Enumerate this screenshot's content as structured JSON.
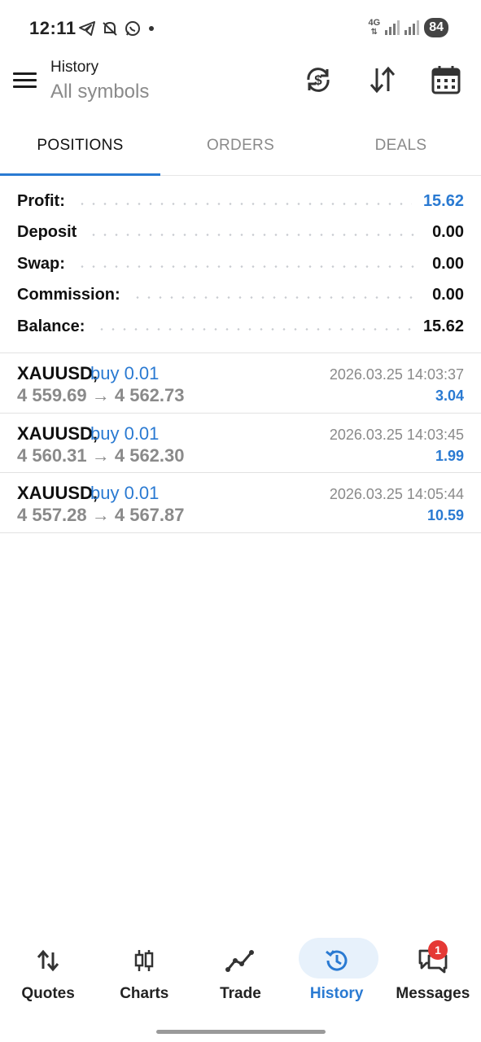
{
  "status_bar": {
    "time": "12:11",
    "network": "4G",
    "battery": "84",
    "left_icons": [
      "telegram-icon",
      "notification-muted-icon",
      "whatsapp-icon",
      "dot-icon"
    ]
  },
  "app_bar": {
    "title": "History",
    "subtitle": "All symbols",
    "icons": [
      "menu-icon",
      "currency-refresh-icon",
      "sort-icon",
      "calendar-icon"
    ]
  },
  "tabs": [
    {
      "label": "POSITIONS",
      "active": true
    },
    {
      "label": "ORDERS",
      "active": false
    },
    {
      "label": "DEALS",
      "active": false
    }
  ],
  "summary": [
    {
      "label": "Profit:",
      "value": "15.62",
      "highlight": true
    },
    {
      "label": "Deposit",
      "value": "0.00",
      "highlight": false
    },
    {
      "label": "Swap:",
      "value": "0.00",
      "highlight": false
    },
    {
      "label": "Commission:",
      "value": "0.00",
      "highlight": false
    },
    {
      "label": "Balance:",
      "value": "15.62",
      "highlight": false
    }
  ],
  "positions": [
    {
      "symbol": "XAUUSD,",
      "side": "buy 0.01",
      "prices": "4 559.69 → 4 562.73",
      "time": "2026.03.25 14:03:37",
      "profit": "3.04"
    },
    {
      "symbol": "XAUUSD,",
      "side": "buy 0.01",
      "prices": "4 560.31 → 4 562.30",
      "time": "2026.03.25 14:03:45",
      "profit": "1.99"
    },
    {
      "symbol": "XAUUSD,",
      "side": "buy 0.01",
      "prices": "4 557.28 → 4 567.87",
      "time": "2026.03.25 14:05:44",
      "profit": "10.59"
    }
  ],
  "bottom_nav": [
    {
      "label": "Quotes",
      "icon": "quotes-arrows-icon",
      "active": false
    },
    {
      "label": "Charts",
      "icon": "candlestick-icon",
      "active": false
    },
    {
      "label": "Trade",
      "icon": "trend-line-icon",
      "active": false
    },
    {
      "label": "History",
      "icon": "history-clock-icon",
      "active": true
    },
    {
      "label": "Messages",
      "icon": "messages-icon",
      "active": false
    }
  ],
  "messages_badge": "1",
  "colors": {
    "accent": "#2a7ad2",
    "muted_text": "#8a8a8a",
    "badge": "#e53935"
  }
}
